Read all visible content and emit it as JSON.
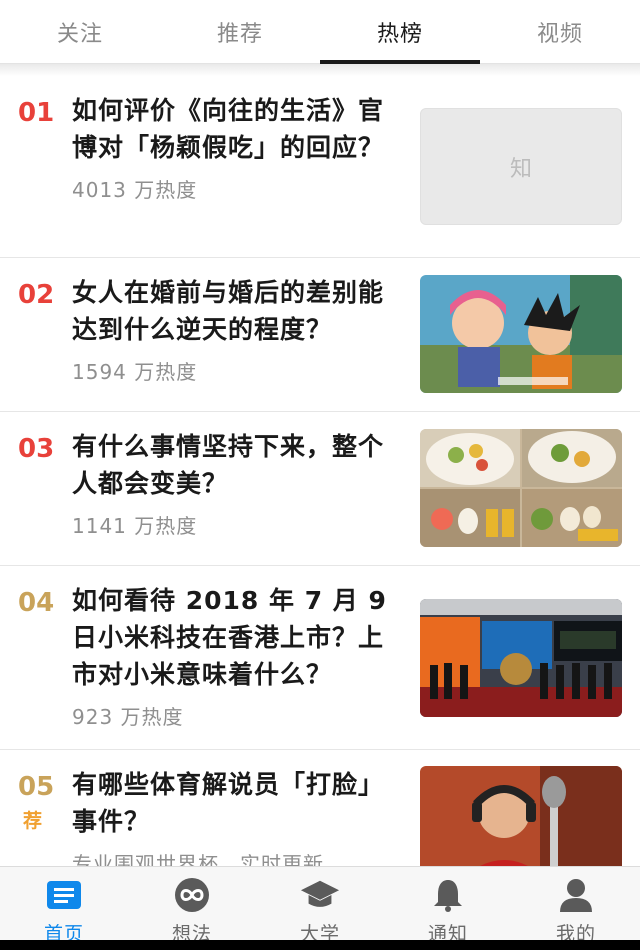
{
  "tabs": [
    {
      "label": "关注",
      "active": false
    },
    {
      "label": "推荐",
      "active": false
    },
    {
      "label": "热榜",
      "active": true
    },
    {
      "label": "视频",
      "active": false
    }
  ],
  "items": [
    {
      "rank": "01",
      "title": "如何评价《向往的生活》官博对「杨颖假吃」的回应？",
      "heat": "4013 万热度",
      "thumb_text": "知",
      "thumb_icon": "placeholder-logo"
    },
    {
      "rank": "02",
      "title": "女人在婚前与婚后的差别能达到什么逆天的程度？",
      "heat": "1594 万热度",
      "thumb_icon": "cartoon-image"
    },
    {
      "rank": "03",
      "title": "有什么事情坚持下来，整个人都会变美？",
      "heat": "1141 万热度",
      "thumb_icon": "food-collage-image"
    },
    {
      "rank": "04",
      "title": "如何看待 2018 年 7 月 9 日小米科技在香港上市？上市对小米意味着什么？",
      "heat": "923 万热度",
      "thumb_icon": "ipo-ceremony-image"
    },
    {
      "rank": "05",
      "badge": "荐",
      "title": "有哪些体育解说员「打脸」事件？",
      "heat": "专业围观世界杯，实时更新",
      "thumb_icon": "commentator-photo"
    }
  ],
  "nav": [
    {
      "label": "首页",
      "icon": "home-icon",
      "active": true
    },
    {
      "label": "想法",
      "icon": "ideas-icon",
      "active": false
    },
    {
      "label": "大学",
      "icon": "university-icon",
      "active": false
    },
    {
      "label": "通知",
      "icon": "bell-icon",
      "active": false
    },
    {
      "label": "我的",
      "icon": "profile-icon",
      "active": false
    }
  ],
  "colors": {
    "rank_hot": "#e8413a",
    "rank_normal": "#c9a35a",
    "accent": "#0f88eb",
    "recommend": "#f0a030"
  }
}
